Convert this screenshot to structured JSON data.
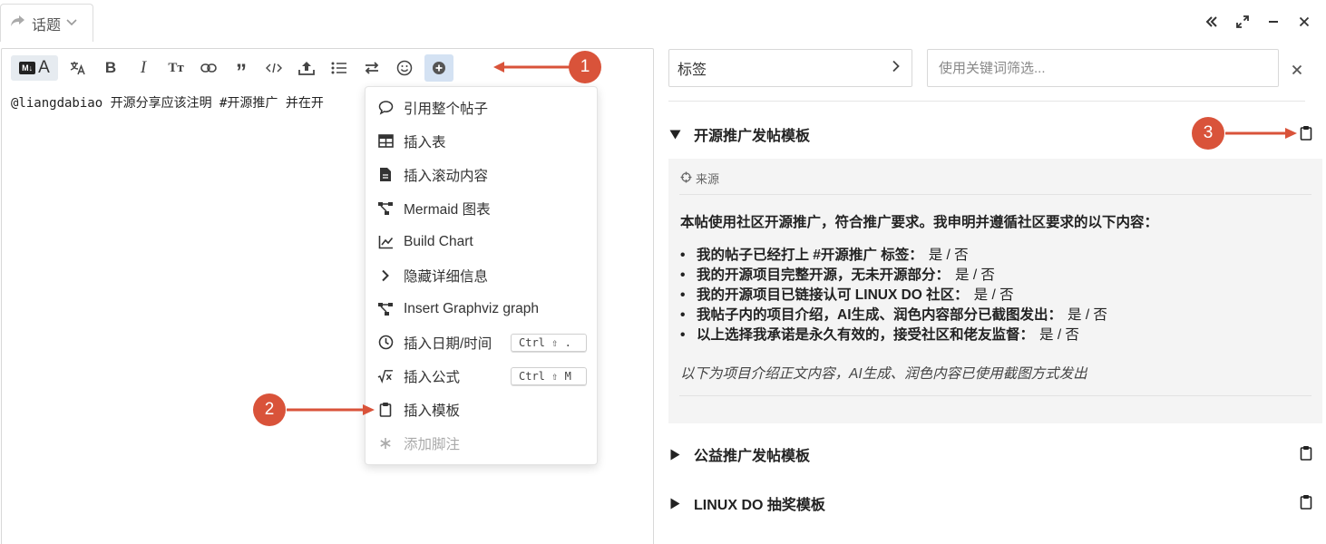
{
  "header": {
    "topic_label": "话题",
    "window_controls": [
      "collapse-left-icon",
      "expand-icon",
      "minimize-icon",
      "close-icon"
    ]
  },
  "toolbar": {
    "buttons": [
      "markdown-toggle",
      "translate-icon",
      "bold-icon",
      "italic-icon",
      "text-size-icon",
      "link-icon",
      "quote-icon",
      "code-icon",
      "upload-icon",
      "list-icon",
      "swap-icon",
      "emoji-icon",
      "plus-icon"
    ]
  },
  "editor": {
    "content": "@liangdabiao 开源分享应该注明 #开源推广 并在开"
  },
  "menu": {
    "items": [
      {
        "label": "引用整个帖子",
        "icon": "comment-icon"
      },
      {
        "label": "插入表",
        "icon": "table-icon"
      },
      {
        "label": "插入滚动内容",
        "icon": "document-icon"
      },
      {
        "label": "Mermaid 图表",
        "icon": "diagram-icon"
      },
      {
        "label": "Build Chart",
        "icon": "line-chart-icon"
      },
      {
        "label": "隐藏详细信息",
        "icon": "chevron-right-icon"
      },
      {
        "label": "Insert Graphviz graph",
        "icon": "diagram-icon"
      },
      {
        "label": "插入日期/时间",
        "icon": "clock-icon",
        "shortcut": "Ctrl ⇧ ."
      },
      {
        "label": "插入公式",
        "icon": "sqrt-icon",
        "shortcut": "Ctrl ⇧ M"
      },
      {
        "label": "插入模板",
        "icon": "clipboard-icon"
      },
      {
        "label": "添加脚注",
        "icon": "asterisk-icon",
        "disabled": true
      }
    ]
  },
  "annotations": {
    "badge1": "1",
    "badge2": "2",
    "badge3": "3",
    "color": "#d9533a"
  },
  "right_panel": {
    "selector_label": "标签",
    "filter_placeholder": "使用关键词筛选...",
    "templates": [
      {
        "title": "开源推广发帖模板",
        "expanded": true,
        "source_label": "来源",
        "intro": "本帖使用社区开源推广，符合推广要求。我申明并遵循社区要求的以下内容：",
        "items": [
          {
            "q": "我的帖子已经打上 #开源推广 标签：",
            "a": "是 / 否"
          },
          {
            "q": "我的开源项目完整开源，无未开源部分：",
            "a": "是 / 否"
          },
          {
            "q": "我的开源项目已链接认可 LINUX DO 社区：",
            "a": "是 / 否"
          },
          {
            "q": "我帖子内的项目介绍，AI生成、润色内容部分已截图发出：",
            "a": "是 / 否"
          },
          {
            "q": "以上选择我承诺是永久有效的，接受社区和佬友监督：",
            "a": "是 / 否"
          }
        ],
        "note": "以下为项目介绍正文内容，AI生成、润色内容已使用截图方式发出"
      },
      {
        "title": "公益推广发帖模板",
        "expanded": false
      },
      {
        "title": "LINUX DO 抽奖模板",
        "expanded": false
      }
    ]
  }
}
